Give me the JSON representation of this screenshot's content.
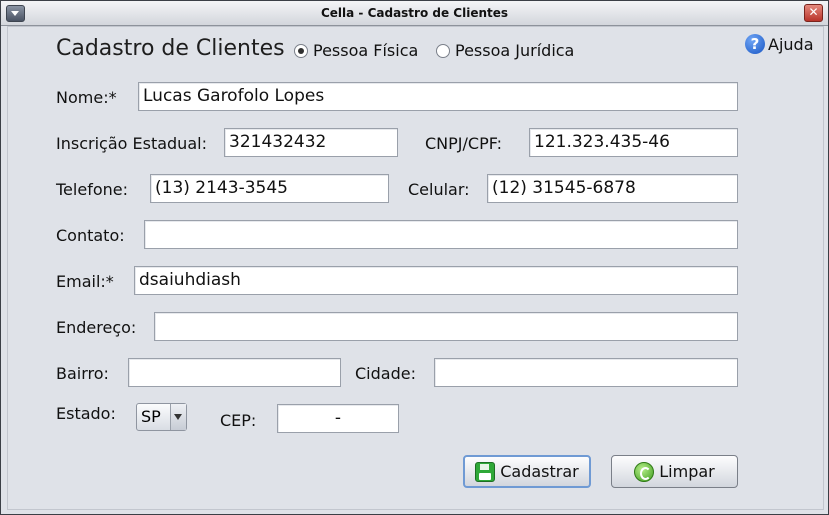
{
  "window": {
    "title": "Cella - Cadastro de Clientes",
    "close_glyph": "✕"
  },
  "header": {
    "title": "Cadastro de Clientes",
    "radio_fisica": "Pessoa Física",
    "radio_juridica": "Pessoa Jurídica",
    "selected": "Pessoa Física",
    "help_label": "Ajuda",
    "help_glyph": "?"
  },
  "form": {
    "nome_label": "Nome:*",
    "nome_value": "Lucas Garofolo Lopes",
    "ie_label": "Inscrição Estadual:",
    "ie_value": "321432432",
    "cnpj_label": "CNPJ/CPF:",
    "cnpj_value": "121.323.435-46",
    "telefone_label": "Telefone:",
    "telefone_value": "(13) 2143-3545",
    "celular_label": "Celular:",
    "celular_value": "(12) 31545-6878",
    "contato_label": "Contato:",
    "contato_value": "",
    "email_label": "Email:*",
    "email_value": "dsaiuhdiash",
    "endereco_label": "Endereço:",
    "endereco_value": "",
    "bairro_label": "Bairro:",
    "bairro_value": "",
    "cidade_label": "Cidade:",
    "cidade_value": "",
    "estado_label": "Estado:",
    "estado_value": "SP",
    "cep_label": "CEP:",
    "cep_value": "-"
  },
  "buttons": {
    "cadastrar": "Cadastrar",
    "limpar": "Limpar"
  },
  "icons": {
    "window_menu": "window-menu-icon",
    "close": "close-icon",
    "help": "help-icon",
    "save": "save-icon",
    "clear": "clear-icon"
  }
}
